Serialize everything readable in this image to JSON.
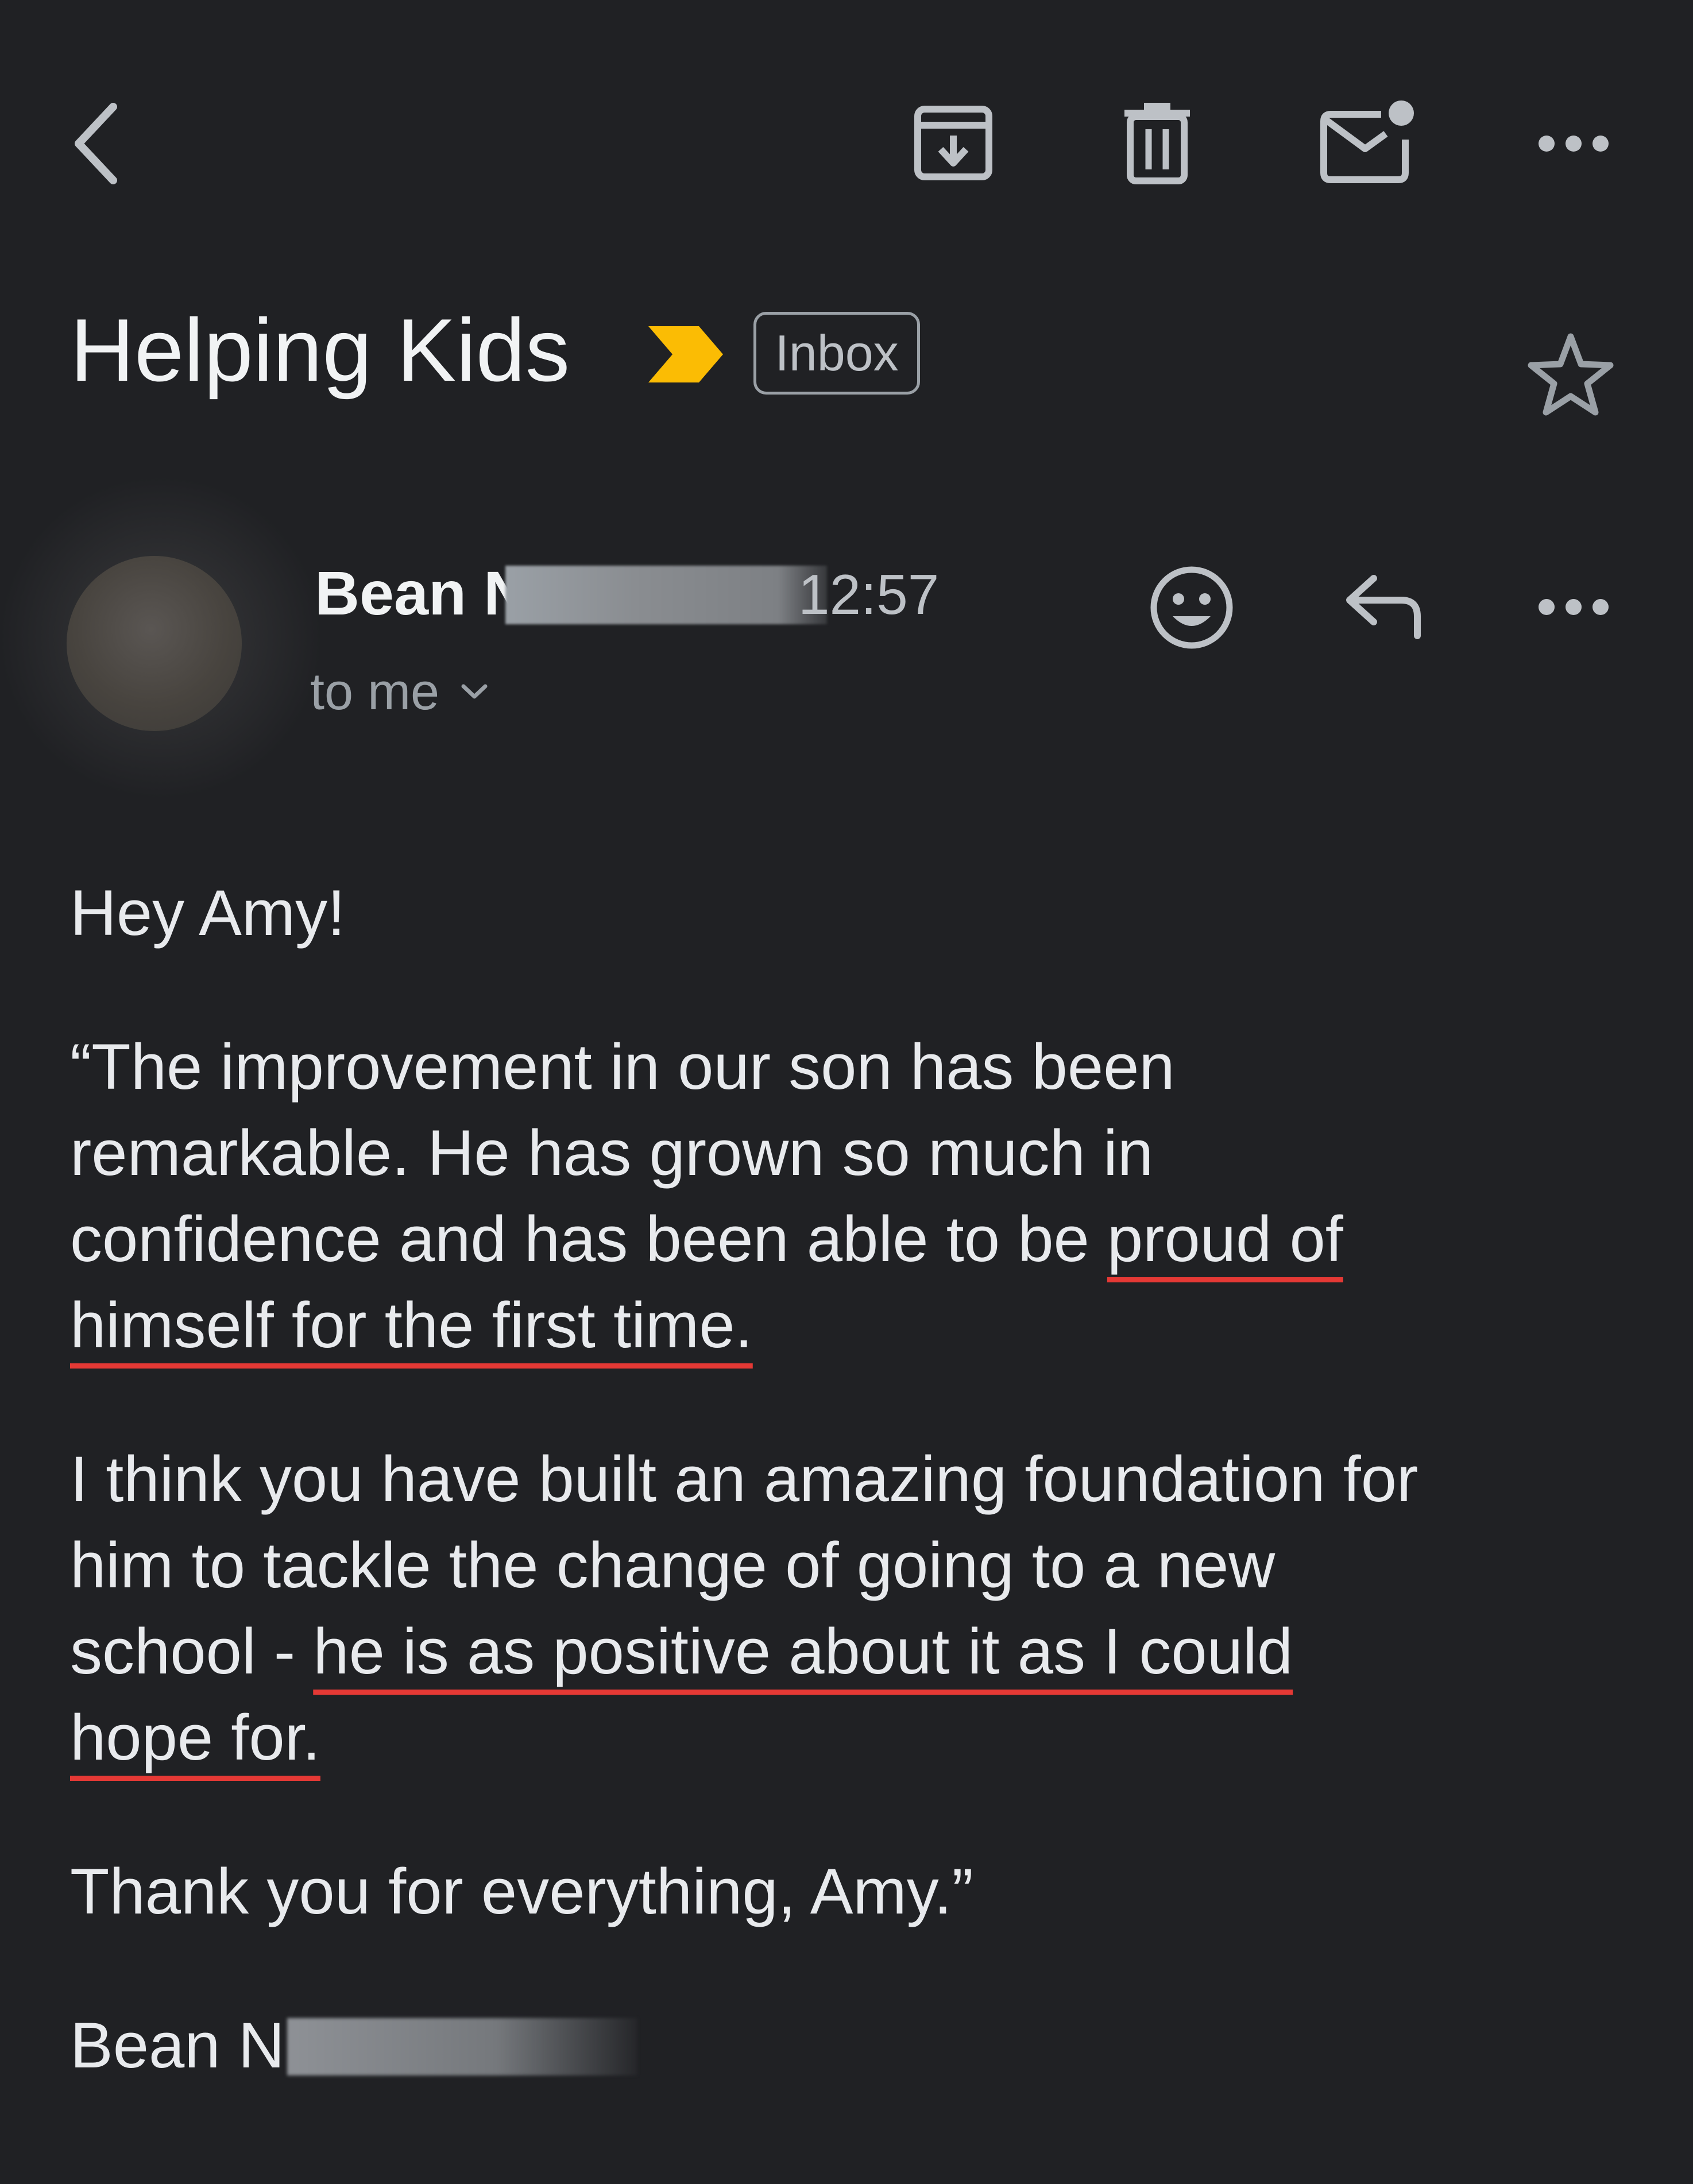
{
  "toolbar": {
    "back_icon": "chevron-left-icon",
    "archive_icon": "archive-icon",
    "delete_icon": "trash-icon",
    "mark_unread_icon": "mail-unread-icon",
    "more_icon": "more-horizontal-icon"
  },
  "subject": {
    "title": "Helping Kids",
    "label": "Inbox",
    "importance_color": "#fbbc04"
  },
  "sender": {
    "name": "Bean N",
    "time": "12:57",
    "recipients": "to me"
  },
  "body": {
    "greeting": "Hey Amy!",
    "p1_line1": "“The improvement in our son has been",
    "p1_line2": "remarkable. He has grown so much in",
    "p1_line3_plain": "confidence and has been able to be ",
    "p1_line3_underlined": "proud of ",
    "p1_line4_underlined": "himself for the first time.",
    "p2_line1": "I think you have built an amazing foundation for",
    "p2_line2": "him to tackle the change of going to a new",
    "p2_line3_plain": "school - ",
    "p2_line3_underlined": "he is as positive about it as I could ",
    "p2_line4_underlined": "hope for.",
    "thanks": "Thank you for everything, Amy.”",
    "signoff": "Bean N"
  },
  "colors": {
    "background": "#202124",
    "underline": "#e53935",
    "importance": "#fbbc04"
  }
}
